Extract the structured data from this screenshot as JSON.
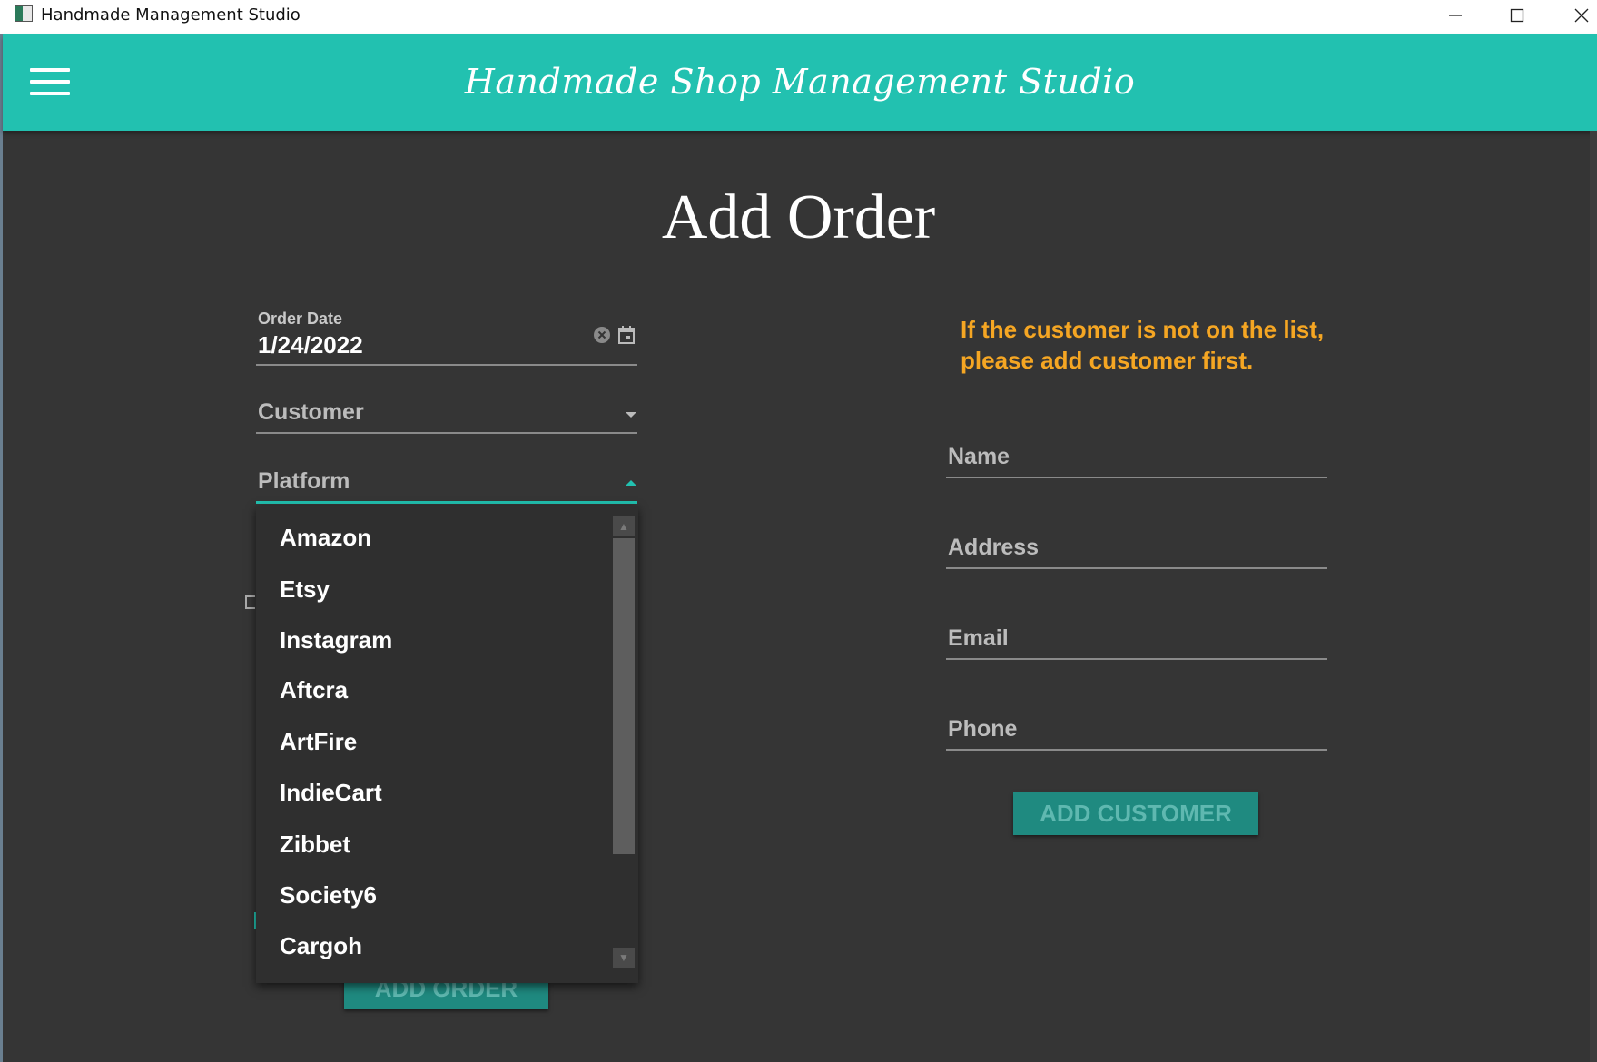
{
  "window": {
    "title": "Handmade Management Studio",
    "controls": [
      "minimize",
      "maximize",
      "close"
    ]
  },
  "appbar": {
    "title": "Handmade Shop Management Studio",
    "menu_icon": "hamburger-menu-icon",
    "background": "#22c1b0"
  },
  "page": {
    "title": "Add Order"
  },
  "order_form": {
    "order_date_label": "Order Date",
    "order_date_value": "1/24/2022",
    "customer_placeholder": "Customer",
    "platform_placeholder": "Platform",
    "platform_options": [
      "Amazon",
      "Etsy",
      "Instagram",
      "Aftcra",
      "ArtFire",
      "IndieCart",
      "Zibbet",
      "Society6",
      "Cargoh"
    ],
    "submit_label": "ADD ORDER"
  },
  "customer_form": {
    "notice": "If the customer is not on the list, please add customer first.",
    "name_placeholder": "Name",
    "address_placeholder": "Address",
    "email_placeholder": "Email",
    "phone_placeholder": "Phone",
    "submit_label": "ADD CUSTOMER"
  },
  "colors": {
    "accent": "#22c1b0",
    "background": "#353535",
    "notice": "#f5a623",
    "button": "#1f8a80"
  }
}
